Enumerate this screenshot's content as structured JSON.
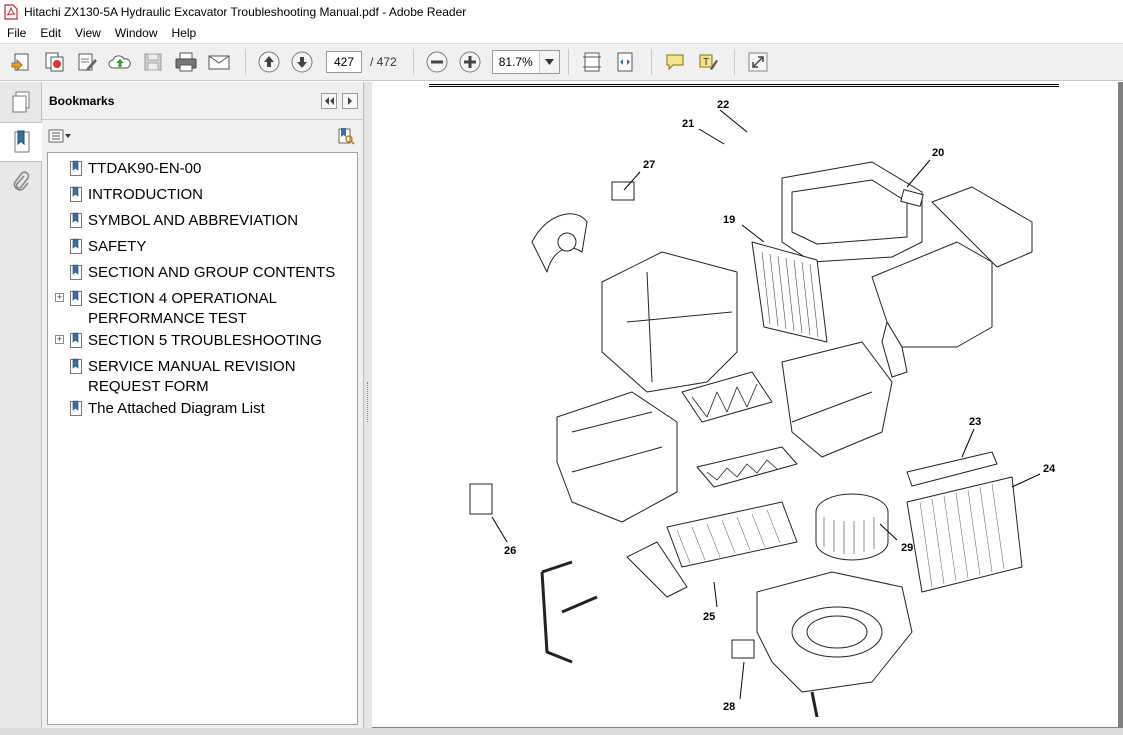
{
  "window": {
    "title": "Hitachi ZX130-5A Hydraulic Excavator Troubleshooting  Manual.pdf - Adobe Reader"
  },
  "menu": [
    "File",
    "Edit",
    "View",
    "Window",
    "Help"
  ],
  "toolbar": {
    "current_page": "427",
    "total_pages": "/ 472",
    "zoom": "81.7%"
  },
  "bookmarks": {
    "title": "Bookmarks",
    "items": [
      {
        "label": "TTDAK90-EN-00",
        "expandable": false
      },
      {
        "label": "INTRODUCTION",
        "expandable": false
      },
      {
        "label": "SYMBOL AND ABBREVIATION",
        "expandable": false
      },
      {
        "label": "SAFETY",
        "expandable": false
      },
      {
        "label": "SECTION AND GROUP CONTENTS",
        "expandable": false
      },
      {
        "label": "SECTION 4 OPERATIONAL PERFORMANCE TEST",
        "expandable": true,
        "expander": "+"
      },
      {
        "label": "SECTION 5 TROUBLESHOOTING",
        "expandable": true,
        "expander": "+"
      },
      {
        "label": "SERVICE MANUAL REVISION REQUEST FORM",
        "expandable": false
      },
      {
        "label": "The Attached Diagram List",
        "expandable": false
      }
    ]
  },
  "diagram": {
    "callouts": [
      "22",
      "21",
      "20",
      "27",
      "19",
      "23",
      "24",
      "29",
      "26",
      "25",
      "28"
    ]
  },
  "icons": {
    "toolbar": [
      "create-pdf-icon",
      "combine-icon",
      "edit-icon",
      "cloud-upload-icon",
      "save-icon",
      "print-icon",
      "email-icon",
      "page-up-icon",
      "page-down-icon",
      "zoom-out-icon",
      "zoom-in-icon",
      "fit-page-icon",
      "fit-width-icon",
      "comment-icon",
      "highlight-icon",
      "fullscreen-icon"
    ]
  },
  "colors": {
    "toolbar_bg": "#f0f0f0",
    "document_bg": "#808080",
    "pdf_icon_red": "#c8262b"
  }
}
